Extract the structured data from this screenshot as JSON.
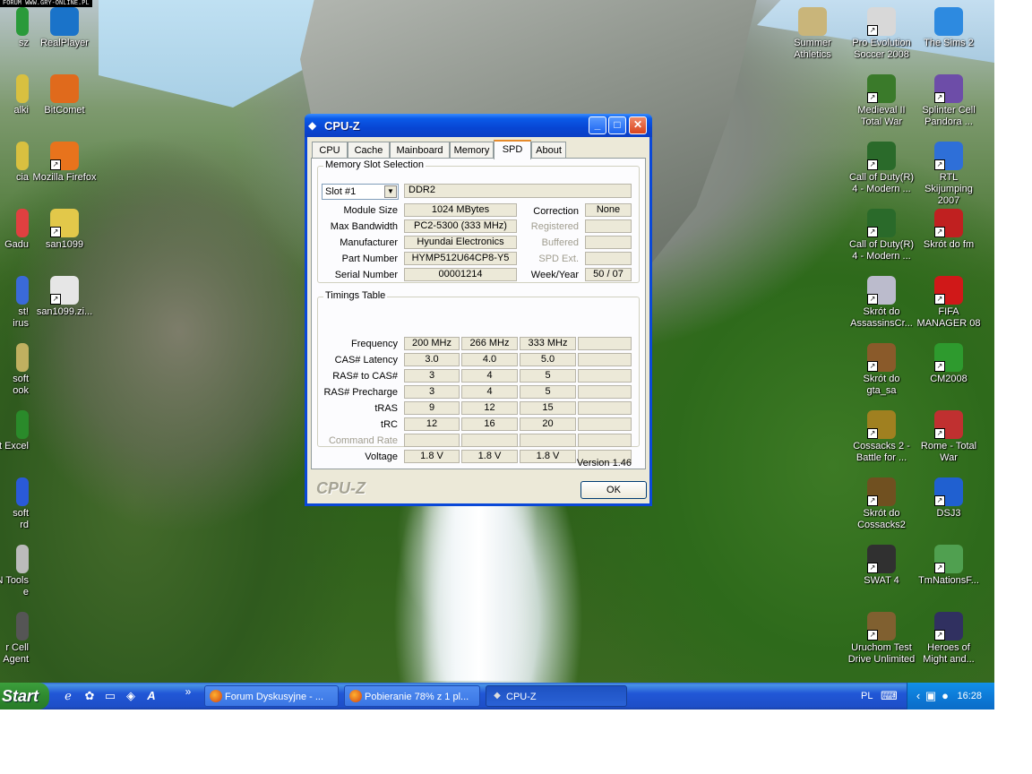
{
  "watermark": "FORUM WWW.GRY-ONLINE.PL",
  "desktop_icons_left": [
    {
      "label": "sz"
    },
    {
      "label": "alki"
    },
    {
      "label": "cia"
    },
    {
      "label": "Gadu"
    },
    {
      "label": "st!\nirus"
    },
    {
      "label": "soft\nook"
    },
    {
      "label": "t Excel"
    },
    {
      "label": "soft\nrd"
    },
    {
      "label": "N Tools\ne"
    },
    {
      "label": "r Cell\nAgent"
    }
  ],
  "desktop_icons": [
    {
      "label": "RealPlayer"
    },
    {
      "label": "BitComet"
    },
    {
      "label": "Mozilla Firefox"
    },
    {
      "label": "san1099"
    },
    {
      "label": "san1099.zi..."
    },
    {
      "label": "Summer\nAthletics"
    },
    {
      "label": "Pro Evolution\nSoccer 2008"
    },
    {
      "label": "The Sims 2"
    },
    {
      "label": "Medieval II\nTotal War"
    },
    {
      "label": "Splinter Cell\nPandora ..."
    },
    {
      "label": "Call of Duty(R)\n4 - Modern ..."
    },
    {
      "label": "RTL Skijumping\n2007"
    },
    {
      "label": "Call of Duty(R)\n4 - Modern ..."
    },
    {
      "label": "Skrót do fm"
    },
    {
      "label": "Skrót do\nAssassinsCr..."
    },
    {
      "label": "FIFA\nMANAGER 08"
    },
    {
      "label": "Skrót do\ngta_sa"
    },
    {
      "label": "CM2008"
    },
    {
      "label": "Cossacks 2 -\nBattle for ..."
    },
    {
      "label": "Rome - Total\nWar"
    },
    {
      "label": "Skrót do\nCossacks2"
    },
    {
      "label": "DSJ3"
    },
    {
      "label": "SWAT 4"
    },
    {
      "label": "TmNationsF..."
    },
    {
      "label": "Uruchom Test\nDrive Unlimited"
    },
    {
      "label": "Heroes of\nMight and..."
    }
  ],
  "window": {
    "title": "CPU-Z",
    "tabs": [
      "CPU",
      "Cache",
      "Mainboard",
      "Memory",
      "SPD",
      "About"
    ],
    "active_tab": "SPD",
    "memory_slot": {
      "group_label": "Memory Slot Selection",
      "slot_selected": "Slot #1",
      "type": "DDR2",
      "module_size": {
        "label": "Module Size",
        "value": "1024 MBytes"
      },
      "max_bandwidth": {
        "label": "Max Bandwidth",
        "value": "PC2-5300 (333 MHz)"
      },
      "manufacturer": {
        "label": "Manufacturer",
        "value": "Hyundai Electronics"
      },
      "part_number": {
        "label": "Part Number",
        "value": "HYMP512U64CP8-Y5"
      },
      "serial_number": {
        "label": "Serial Number",
        "value": "00001214"
      },
      "correction": {
        "label": "Correction",
        "value": "None"
      },
      "registered": {
        "label": "Registered",
        "value": ""
      },
      "buffered": {
        "label": "Buffered",
        "value": ""
      },
      "spd_ext": {
        "label": "SPD Ext.",
        "value": ""
      },
      "week_year": {
        "label": "Week/Year",
        "value": "50 / 07"
      }
    },
    "timings": {
      "group_label": "Timings Table",
      "rows": [
        {
          "label": "Frequency",
          "values": [
            "200 MHz",
            "266 MHz",
            "333 MHz",
            ""
          ],
          "disabled": false
        },
        {
          "label": "CAS# Latency",
          "values": [
            "3.0",
            "4.0",
            "5.0",
            ""
          ],
          "disabled": false
        },
        {
          "label": "RAS# to CAS#",
          "values": [
            "3",
            "4",
            "5",
            ""
          ],
          "disabled": false
        },
        {
          "label": "RAS# Precharge",
          "values": [
            "3",
            "4",
            "5",
            ""
          ],
          "disabled": false
        },
        {
          "label": "tRAS",
          "values": [
            "9",
            "12",
            "15",
            ""
          ],
          "disabled": false
        },
        {
          "label": "tRC",
          "values": [
            "12",
            "16",
            "20",
            ""
          ],
          "disabled": false
        },
        {
          "label": "Command Rate",
          "values": [
            "",
            "",
            "",
            ""
          ],
          "disabled": true
        },
        {
          "label": "Voltage",
          "values": [
            "1.8 V",
            "1.8 V",
            "1.8 V",
            ""
          ],
          "disabled": false
        }
      ]
    },
    "version": "Version 1.46",
    "logo": "CPU-Z",
    "ok_label": "OK"
  },
  "taskbar": {
    "start_label": "Start",
    "chevron": "»",
    "buttons": [
      {
        "label": "Forum Dyskusyjne - ...",
        "icon": "firefox-icon"
      },
      {
        "label": "Pobieranie 78% z 1 pl...",
        "icon": "firefox-icon"
      },
      {
        "label": "CPU-Z",
        "icon": "cpuz-icon",
        "active": true
      }
    ],
    "language": "PL",
    "clock": "16:28"
  },
  "colors": {
    "titlebar": "#0b5be8",
    "taskbar": "#2157d7",
    "start": "#2f8a2f",
    "tab_highlight": "#e68b2c"
  }
}
